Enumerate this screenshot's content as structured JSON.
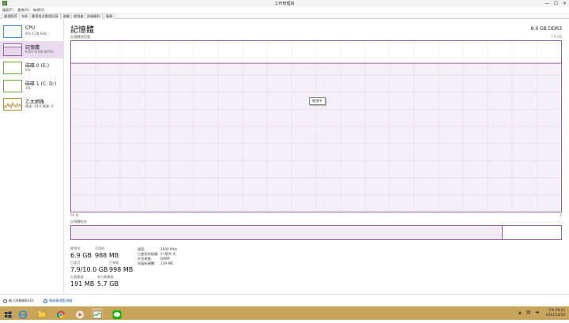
{
  "window": {
    "title": "工作管理員",
    "min": "—",
    "max": "☐",
    "close": "✕"
  },
  "menu": [
    "檔案(F)",
    "選項(O)",
    "檢視(V)"
  ],
  "tabs": [
    "處理程序",
    "效能",
    "應用程式歷程記錄",
    "啟動",
    "使用者",
    "詳細資料",
    "服務"
  ],
  "active_tab": 1,
  "sidebar": [
    {
      "title": "CPU",
      "sub": "4% 1.28 GHz",
      "color": "#4a90d9"
    },
    {
      "title": "記憶體",
      "sub": "6.9/7.9 GB (87%)",
      "color": "#9b5fae"
    },
    {
      "title": "磁碟 0 (E:)",
      "sub": "0%",
      "color": "#6aa84f"
    },
    {
      "title": "磁碟 1 (C: D:)",
      "sub": "1%",
      "color": "#6aa84f"
    },
    {
      "title": "乙太網路",
      "sub": "傳送: 24.0 接收: 0",
      "color": "#b08a3a"
    }
  ],
  "memory": {
    "title": "記憶體",
    "spec": "8.0 GB DDR3",
    "graph_label": "記憶體使用量",
    "graph_max": "7.9 GB",
    "usage_fraction": 0.87,
    "time_left": "60 秒",
    "time_right": "0",
    "composition_label": "記憶體組合",
    "composition_used_fraction": 0.88,
    "tooltip": "使用中",
    "stats": {
      "in_use_label": "使用中",
      "in_use": "6.9 GB",
      "available_label": "可用的",
      "available": "988 MB",
      "committed_label": "已認可",
      "committed": "7.9/10.0 GB",
      "cached_label": "已快取",
      "cached": "998 MB",
      "paged_label": "分頁集區",
      "paged": "191 MB",
      "nonpaged_label": "非分頁集區",
      "nonpaged": "5.7 GB"
    },
    "details": [
      {
        "label": "速度:",
        "value": "1600 MHz"
      },
      {
        "label": "已使用的插槽:",
        "value": "2 (總共 4)"
      },
      {
        "label": "外型規格:",
        "value": "DIMM"
      },
      {
        "label": "保留給硬體:",
        "value": "139 MB"
      }
    ]
  },
  "bottom": {
    "fewer": "較少詳細資料(D)",
    "resmon": "開啟資源監視器"
  },
  "taskbar": {
    "time": "下午 09:24",
    "date": "2014/10/19"
  }
}
